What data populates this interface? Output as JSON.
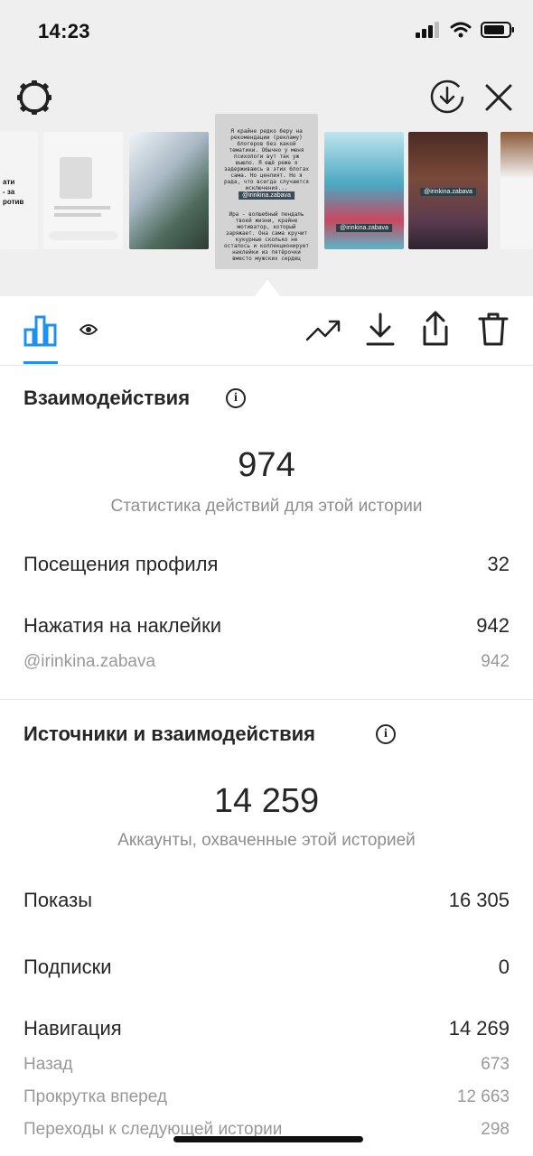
{
  "status_bar": {
    "time": "14:23"
  },
  "story_preview": {
    "selected_caption": "Я крайне редко беру на рекомендации (рекламу) блогеров без какой тематики. Обычно у меня психологи вут так уж вышло. Я ещё реже я задерживаюсь в этих блогах сама. Но ценлият. Но я рада, что всегда случаются исключения...",
    "selected_tag": "@irinkina.zabava",
    "selected_caption_2": "Ира - волшебный пендаль твоей жизни, крайне мотиватор, который заряжает. Она сама кручит кукурные сколько не осталось и коллекционирует наклейки из пятёрочки вместо мужских сердец",
    "thumb_left_text": "ати\n- за\nротив",
    "thumb4_tag": "@irinkina.zabava",
    "thumb5_tag": "@irinkina.zabava"
  },
  "interactions": {
    "title": "Взаимодействия",
    "total": "974",
    "subtitle": "Статистика действий для этой истории",
    "rows": [
      {
        "label": "Посещения профиля",
        "value": "32"
      },
      {
        "label": "Нажатия на наклейки",
        "value": "942"
      }
    ],
    "sub_rows": [
      {
        "label": "@irinkina.zabava",
        "value": "942"
      }
    ]
  },
  "sources": {
    "title": "Источники и взаимодействия",
    "total": "14 259",
    "subtitle": "Аккаунты, охваченные этой историей",
    "rows": [
      {
        "label": "Показы",
        "value": "16 305"
      },
      {
        "label": "Подписки",
        "value": "0"
      },
      {
        "label": "Навигация",
        "value": "14 269"
      }
    ],
    "nav_rows": [
      {
        "label": "Назад",
        "value": "673"
      },
      {
        "label": "Прокрутка вперед",
        "value": "12 663"
      },
      {
        "label": "Переходы к следующей истории",
        "value": "298"
      }
    ]
  },
  "colors": {
    "accent": "#1f8ff0",
    "background_top": "#efefef",
    "text": "#262626",
    "secondary": "#8e8e8e"
  },
  "icons": [
    "settings-gear-icon",
    "download-circle-icon",
    "close-icon",
    "bar-chart-icon",
    "eye-icon",
    "trending-icon",
    "download-icon",
    "share-icon",
    "trash-icon"
  ]
}
